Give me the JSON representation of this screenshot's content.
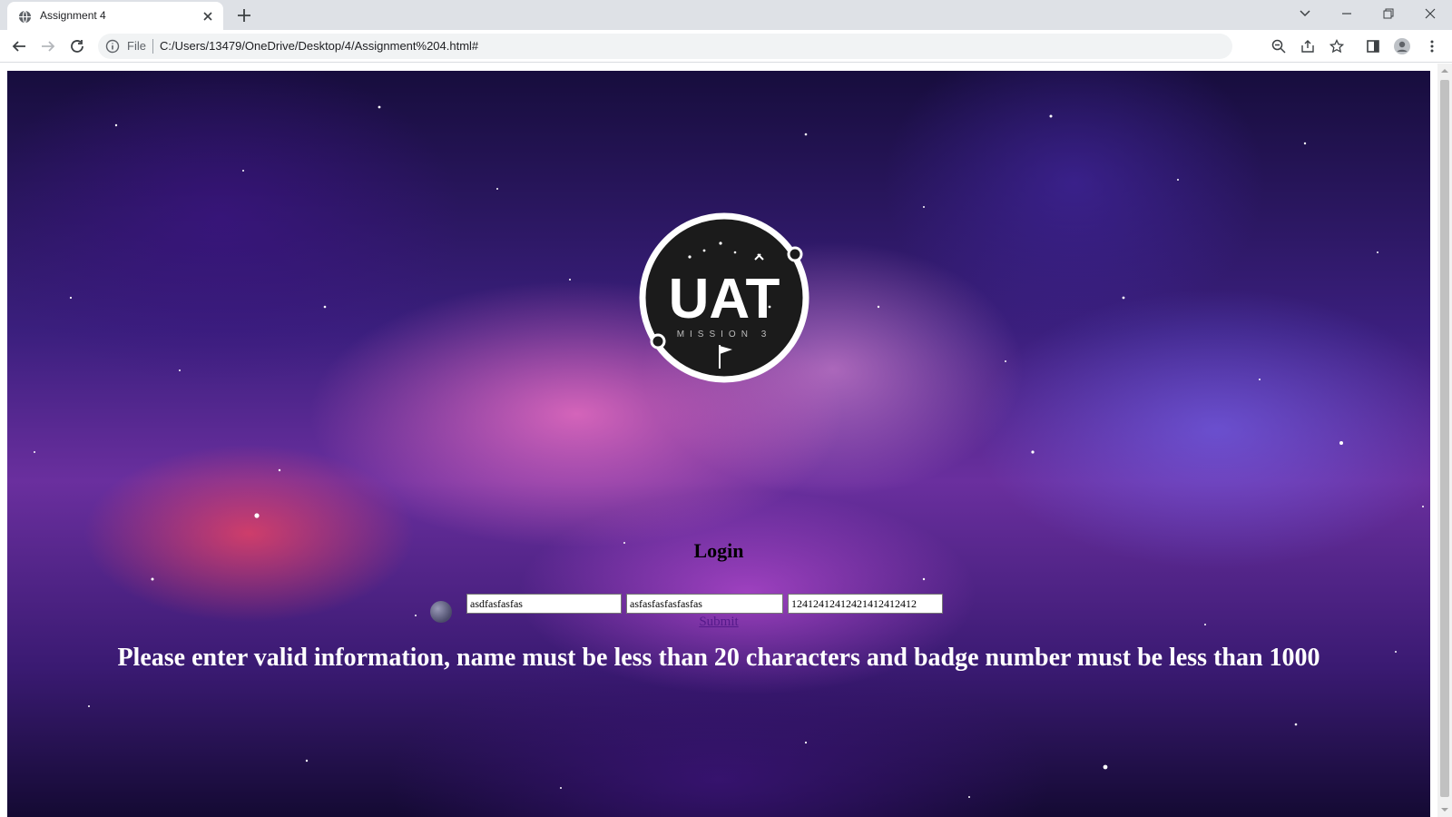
{
  "browser": {
    "tab_title": "Assignment 4",
    "omnibox_scheme_label": "File",
    "url": "C:/Users/13479/OneDrive/Desktop/4/Assignment%204.html#"
  },
  "icons": {
    "tab_favicon": "globe-icon",
    "tab_close": "close-icon",
    "new_tab": "plus-icon",
    "back": "arrow-left-icon",
    "forward": "arrow-right-icon",
    "reload": "reload-icon",
    "site_info": "info-icon",
    "zoom": "zoom-out-icon",
    "share": "share-icon",
    "bookmark": "star-icon",
    "side_panel": "side-panel-icon",
    "profile": "profile-icon",
    "menu": "kebab-menu-icon",
    "tab_search": "chevron-down-icon",
    "minimize": "minimize-icon",
    "restore": "restore-icon",
    "close_window": "close-icon"
  },
  "page": {
    "logo": {
      "main_text": "UAT",
      "sub_text": "MISSION 3"
    },
    "login_title": "Login",
    "fields": [
      {
        "value": "asdfasfasfas"
      },
      {
        "value": "asfasfasfasfasfas"
      },
      {
        "value": "124124124124214124124​12"
      }
    ],
    "submit_label": "Submit",
    "error_message": "Please enter valid information, name must be less than 20 characters and badge number must be less than 1000"
  },
  "colors": {
    "chrome_bg": "#dee1e6",
    "link": "#551a8b",
    "error_text": "#ffffff"
  }
}
